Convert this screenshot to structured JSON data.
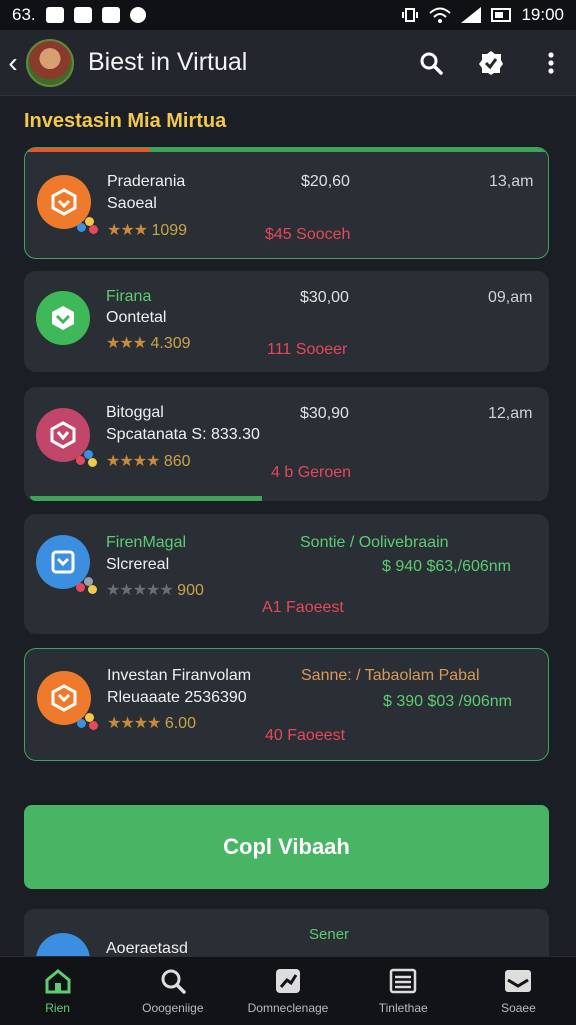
{
  "status_bar": {
    "left_text": "63.",
    "time": "19:00"
  },
  "app_bar": {
    "title": "Biest in Virtual"
  },
  "section": {
    "title": "Investasin Mia Mirtua"
  },
  "cards": [
    {
      "name": "Praderania",
      "sub": "Saoeal",
      "price": "$20,60",
      "time": "13,am",
      "rating": "1099",
      "change": "$45 Sooceh",
      "logo_color": "#ef7a2b"
    },
    {
      "name": "Firana",
      "sub": "Oontetal",
      "price": "$30,00",
      "time": "09,am",
      "rating": "4.309",
      "change": "111 Sooeer",
      "logo_color": "#3fb85a"
    },
    {
      "name": "Bitoggal",
      "sub": "Spcatanata S: 833.30",
      "price": "$30,90",
      "time": "12,am",
      "rating": "860",
      "change": "4 b Geroen",
      "logo_color": "#c2456a"
    },
    {
      "name": "FirenMagal",
      "sub": "Slcrereal",
      "subtitle": "Sontie / Oolivebraain",
      "price": "$ 940  $63,/606nm",
      "rating": "900",
      "change": "A1 Faoeest",
      "logo_color": "#3b8ee0"
    },
    {
      "name": "Investan Firanvolam",
      "sub": "Rleuaaate 2536390",
      "subtitle": "Sanne: / Tabaolam Pabal",
      "price": "$ 390  $03 /906nm",
      "rating": "6.00",
      "change": "40 Faoeest",
      "logo_color": "#ef7a2b"
    }
  ],
  "cta": {
    "label": "Copl Vibaah"
  },
  "peek_card": {
    "name": "Aoeraetasd",
    "subtitle": "Sener"
  },
  "bottom_nav": [
    {
      "label": "Rien",
      "icon": "home-icon",
      "active": true
    },
    {
      "label": "Ooogeniige",
      "icon": "search-icon",
      "active": false
    },
    {
      "label": "Domneclenage",
      "icon": "chart-icon",
      "active": false
    },
    {
      "label": "Tinlethae",
      "icon": "list-icon",
      "active": false
    },
    {
      "label": "Soaee",
      "icon": "inbox-icon",
      "active": false
    }
  ],
  "colors": {
    "accent_green": "#47b564",
    "negative_red": "#e5485a",
    "section_yellow": "#f2c94c"
  }
}
